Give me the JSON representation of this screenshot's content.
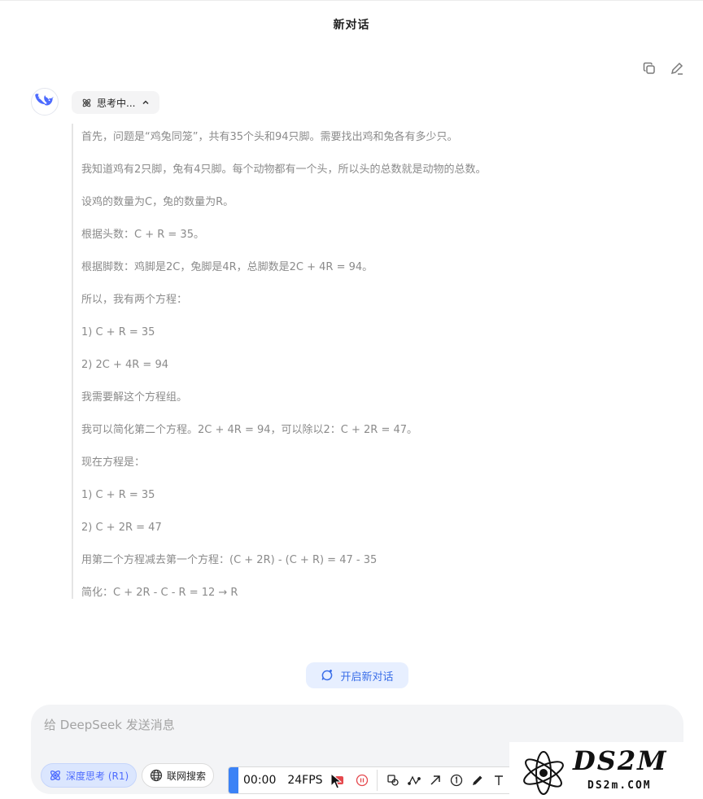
{
  "header": {
    "title": "新对话"
  },
  "icons": {
    "copy": "copy-icon",
    "edit": "edit-icon",
    "avatar": "deepseek-whale-icon"
  },
  "thinking": {
    "toggle_label": "思考中...",
    "lines": [
      "首先，问题是“鸡兔同笼”，共有35个头和94只脚。需要找出鸡和兔各有多少只。",
      "我知道鸡有2只脚，兔有4只脚。每个动物都有一个头，所以头的总数就是动物的总数。",
      "设鸡的数量为C，兔的数量为R。",
      "根据头数：C + R = 35。",
      "根据脚数：鸡脚是2C，兔脚是4R，总脚数是2C + 4R = 94。",
      "所以，我有两个方程：",
      "1) C + R = 35",
      "2) 2C + 4R = 94",
      "我需要解这个方程组。",
      "我可以简化第二个方程。2C + 4R = 94，可以除以2：C + 2R = 47。",
      "现在方程是：",
      "1) C + R = 35",
      "2) C + 2R = 47",
      "用第二个方程减去第一个方程：(C + 2R) - (C + R) = 47 - 35",
      "简化：C + 2R - C - R = 12 → R"
    ]
  },
  "new_chat": {
    "label": "开启新对话"
  },
  "composer": {
    "placeholder": "给 DeepSeek 发送消息",
    "deep_think_label": "深度思考 (R1)",
    "web_search_label": "联网搜索"
  },
  "recorder": {
    "time": "00:00",
    "fps": "24FPS"
  },
  "watermark": {
    "brand": "DS2M",
    "domain": "DS2m.COM"
  },
  "colors": {
    "accent_blue": "#4d6bfe",
    "new_chat_bg": "#e7efff",
    "thinking_text": "#8b8b8b",
    "recorder_accent": "#3b82f6"
  }
}
